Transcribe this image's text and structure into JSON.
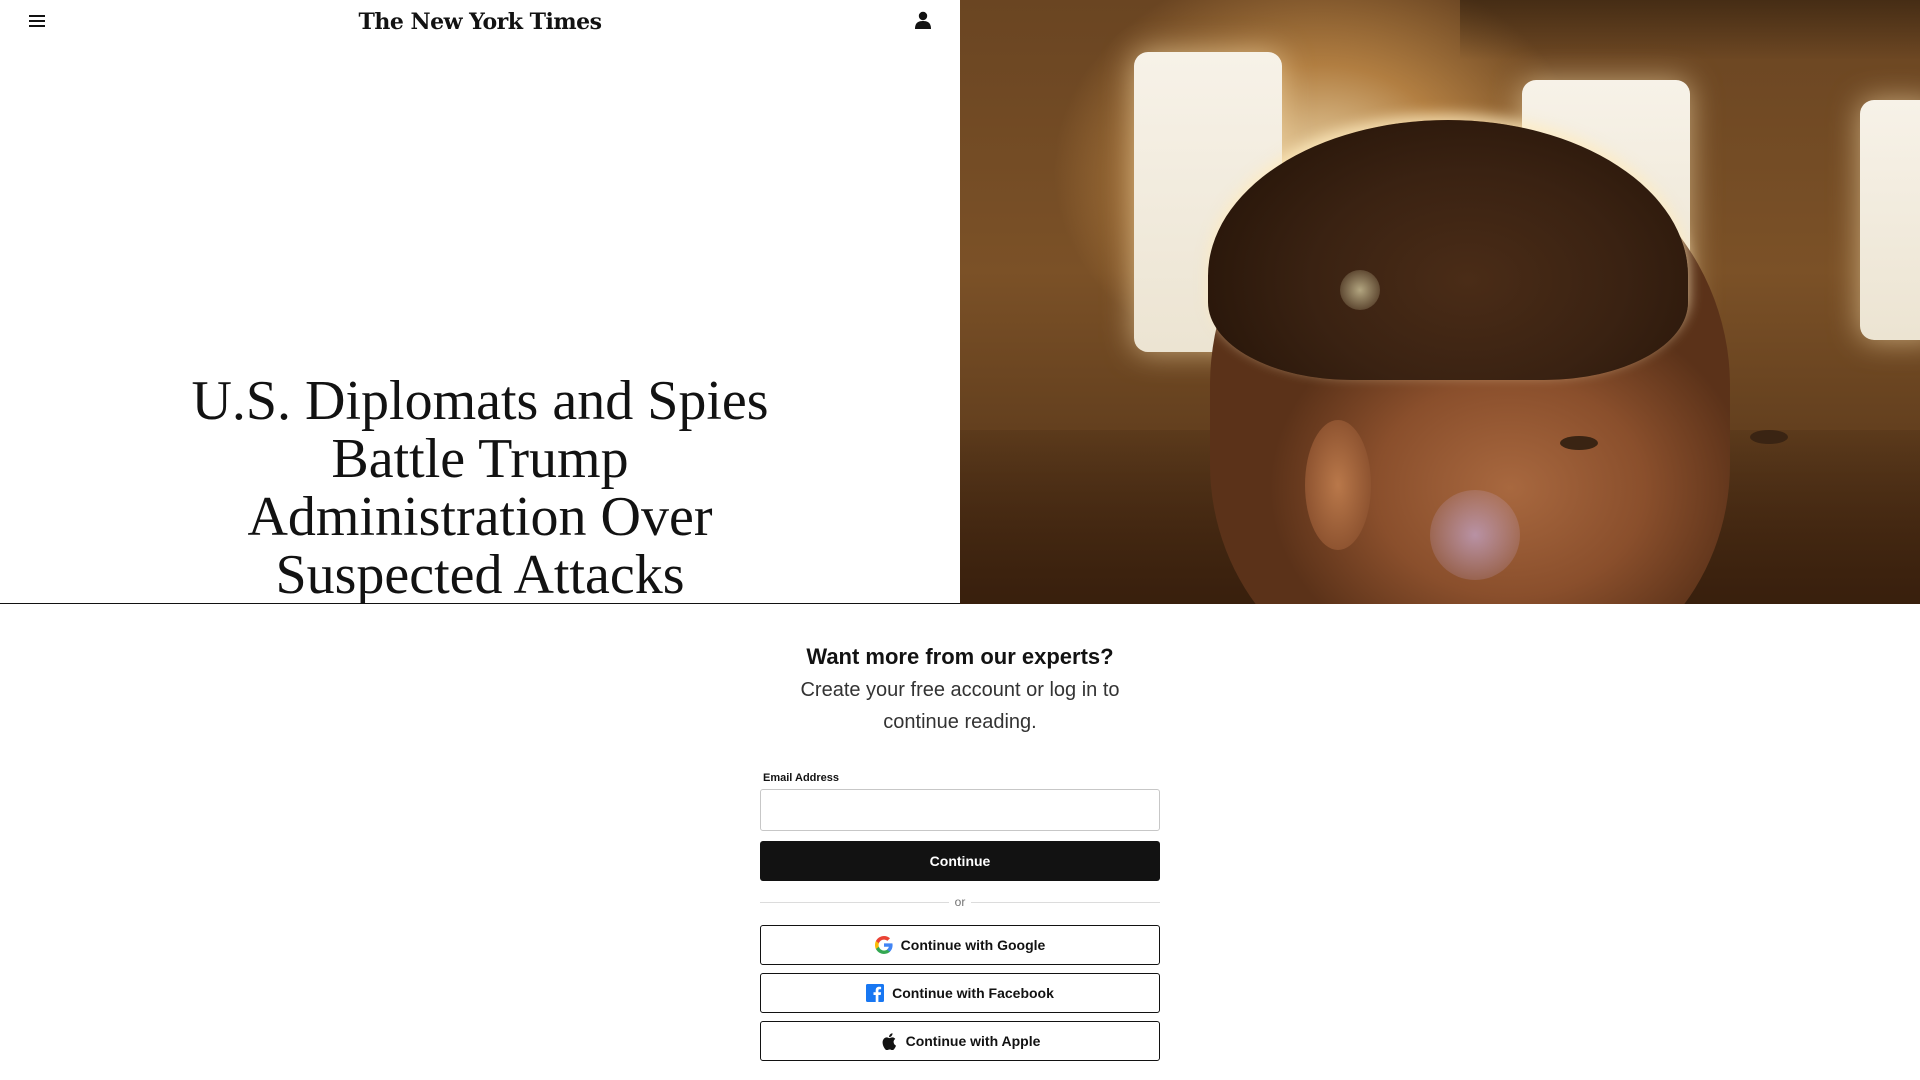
{
  "header": {
    "logo_text": "The New York Times"
  },
  "article": {
    "headline": "U.S. Diplomats and Spies Battle Trump Administration Over Suspected Attacks"
  },
  "login": {
    "title": "Want more from our experts?",
    "subtitle": "Create your free account or log in to continue reading.",
    "email_label": "Email Address",
    "email_value": "",
    "continue_label": "Continue",
    "or_text": "or",
    "google_label": "Continue with Google",
    "facebook_label": "Continue with Facebook",
    "apple_label": "Continue with Apple"
  },
  "icons": {
    "menu": "hamburger-menu-icon",
    "account": "person-icon",
    "google": "google-icon",
    "facebook": "facebook-icon",
    "apple": "apple-icon"
  },
  "colors": {
    "primary": "#121212",
    "google_blue": "#4285F4",
    "google_red": "#EA4335",
    "google_yellow": "#FBBC05",
    "google_green": "#34A853",
    "facebook_blue": "#1877F2"
  }
}
